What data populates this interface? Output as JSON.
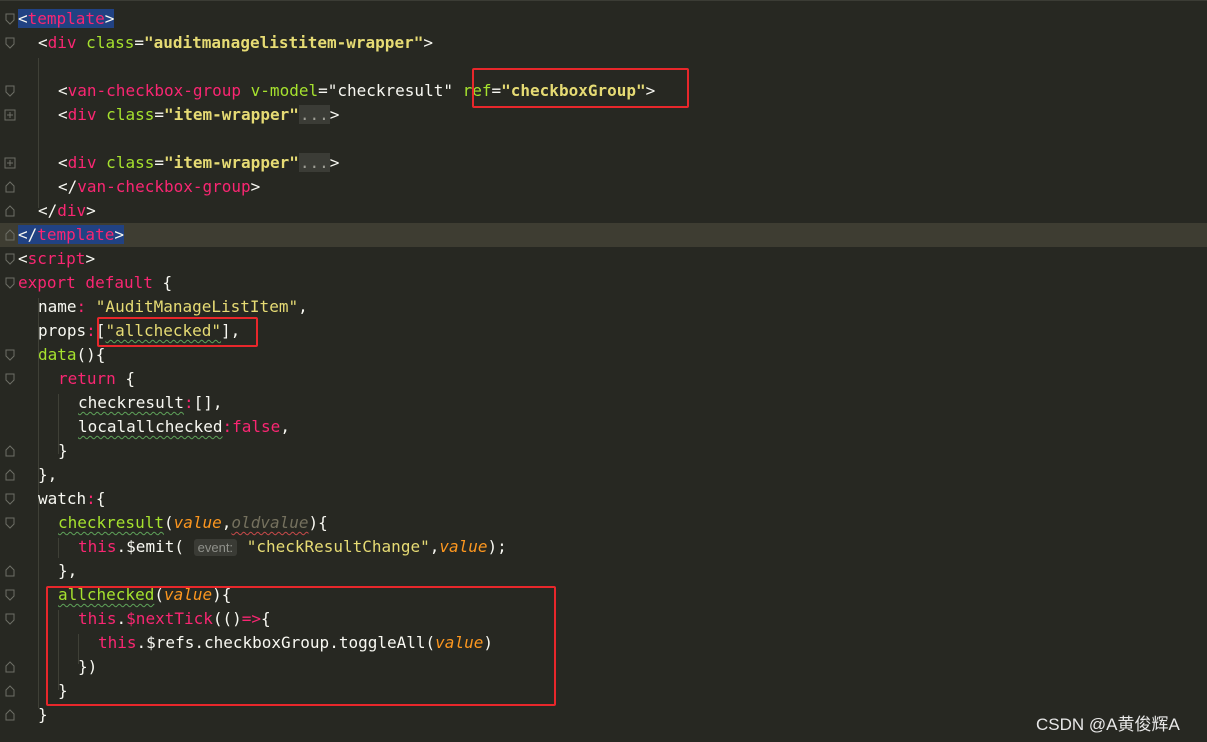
{
  "editor": {
    "lines": {
      "l0": {
        "lt": "<",
        "tag": "template",
        "gt": ">"
      },
      "l1": {
        "lt": "<",
        "tag": "div",
        "attr": " class",
        "eq": "=",
        "val": "\"auditmanagelistitem-wrapper\"",
        "gt": ">"
      },
      "l3": {
        "lt": "<",
        "tag": "van-checkbox-group",
        "attr": " v-model",
        "eq": "=",
        "val": "\"checkresult\"",
        "attr2": " ref",
        "eq2": "=",
        "val2": "\"checkboxGroup\"",
        "gt": ">"
      },
      "l4": {
        "lt": "<",
        "tag": "div",
        "attr": " class",
        "eq": "=",
        "val": "\"item-wrapper\"",
        "fold": "...",
        "gt": ">"
      },
      "l6": {
        "lt": "<",
        "tag": "div",
        "attr": " class",
        "eq": "=",
        "val": "\"item-wrapper\"",
        "fold": "...",
        "gt": ">"
      },
      "l7": {
        "lt": "</",
        "tag": "van-checkbox-group",
        "gt": ">"
      },
      "l8": {
        "lt": "</",
        "tag": "div",
        "gt": ">"
      },
      "l9": {
        "lt": "</",
        "tag": "template",
        "gt": ">"
      },
      "l10": {
        "lt": "<",
        "tag": "script",
        "gt": ">"
      },
      "l11": {
        "kw": "export default",
        "rest": " {"
      },
      "l12": {
        "key": "name",
        "colon": ": ",
        "str": "\"AuditManageListItem\"",
        "rest": ","
      },
      "l13": {
        "key": "props",
        "colon": ":",
        "open": "[",
        "str": "\"allchecked\"",
        "rest": "],"
      },
      "l14": {
        "fn": "data",
        "rest": "(){"
      },
      "l15": {
        "kw": "return",
        "rest": " {"
      },
      "l16": {
        "key": "checkresult",
        "colon": ":",
        "rest": "[],"
      },
      "l17": {
        "key": "localallchecked",
        "colon": ":",
        "kw": "false",
        "rest": ","
      },
      "l18": {
        "rest": "}"
      },
      "l19": {
        "rest": "},"
      },
      "l20": {
        "key": "watch",
        "colon": ":",
        "rest": "{"
      },
      "l21": {
        "fn": "checkresult",
        "p1": "(",
        "arg1": "value",
        "comma": ",",
        "arg2": "oldvalue",
        "rest": "){"
      },
      "l22": {
        "kw": "this",
        "m": ".",
        "call": "$emit",
        "p1": "(",
        "hint": "event:",
        "str": "\"checkResultChange\"",
        "comma": ",",
        "arg": "value",
        "rest": ");"
      },
      "l23": {
        "rest": "},"
      },
      "l24": {
        "fn": "allchecked",
        "p1": "(",
        "arg": "value",
        "rest": "){"
      },
      "l25": {
        "kw": "this",
        "m": ".",
        "call": "$nextTick",
        "p1": "(()",
        "arrow": "=>",
        "rest": "{"
      },
      "l26": {
        "kw": "this",
        "m": ".$refs.checkboxGroup.",
        "call": "toggleAll",
        "p1": "(",
        "arg": "value",
        "rest": ")"
      },
      "l27": {
        "rest": "})"
      },
      "l28": {
        "rest": "}"
      },
      "l29": {
        "rest": "}"
      }
    }
  },
  "watermark": "CSDN @A黄俊辉A",
  "colors": {
    "background": "#272822",
    "tag": "#f92672",
    "attribute": "#a6e22e",
    "string": "#e6db74",
    "param": "#fd971f",
    "highlight_box": "#e8272b"
  }
}
